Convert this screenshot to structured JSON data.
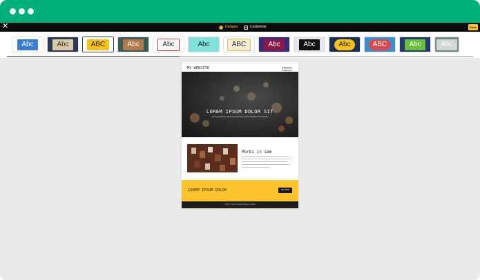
{
  "toolbar": {
    "close_glyph": "✕",
    "designs_label": "Designs",
    "customise_label": "Customise",
    "done_label": "Done"
  },
  "theme_tiles": [
    {
      "label": "Abc",
      "bg": "#ffffff",
      "fg": "#ffffff",
      "inner": "#3a7bd5"
    },
    {
      "label": "Abc",
      "bg": "#2b3a55",
      "fg": "#333333",
      "inner": "#d8c9a8"
    },
    {
      "label": "ABC",
      "bg": "#ffffff",
      "fg": "#222222",
      "inner": "#f4c21a"
    },
    {
      "label": "Abc",
      "bg": "#3c5a55",
      "fg": "#ffffff",
      "inner": "#b07a4a"
    },
    {
      "label": "Abc",
      "bg": "#ffffff",
      "fg": "#222222",
      "inner": "#ffffff"
    },
    {
      "label": "Abc",
      "bg": "#7fe3dc",
      "fg": "#222222",
      "inner": "#7fe3dc"
    },
    {
      "label": "ABC",
      "bg": "#ffffff",
      "fg": "#222222",
      "inner": "#f6edd4"
    },
    {
      "label": "Abc",
      "bg": "#3a2a7a",
      "fg": "#ffffff",
      "inner": "#8b1a4a"
    },
    {
      "label": "Abc",
      "bg": "#e6e6ee",
      "fg": "#ffffff",
      "inner": "#111111"
    },
    {
      "label": "Abc",
      "bg": "#1a2e55",
      "fg": "#222222",
      "inner": "#f4c21a"
    },
    {
      "label": "ABC",
      "bg": "#3a8fd0",
      "fg": "#ffffff",
      "inner": "#d94a4a"
    },
    {
      "label": "Abc",
      "bg": "#1d3b6e",
      "fg": "#ffffff",
      "inner": "#6abf3a"
    },
    {
      "label": "Abc",
      "bg": "#6f8a7a",
      "fg": "#ffffff",
      "inner": "#cfd8d2"
    }
  ],
  "preview": {
    "site_name": "MY WEBSITE",
    "header_button": "Get Yes",
    "hero_title": "LOREM IPSUM DOLOR SIT",
    "hero_subtitle": "Sed ut perspiciatis unde omnis iste natus error sit voluptatem accusantium",
    "mid_title": "Morbi in sem",
    "cta_text": "LOREM IPSUM DOLOR",
    "cta_button": "GET NOW",
    "copyright": "© 2016. Publish Website Builder all rights"
  },
  "colors": {
    "chrome": "#00b07b",
    "accent_yellow": "#fcc42c"
  }
}
